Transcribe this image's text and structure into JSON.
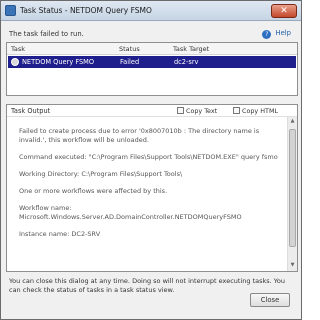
{
  "window": {
    "title": "Task Status - NETDOM Query FSMO",
    "close_glyph": "✕"
  },
  "status_message": "The task failed to run.",
  "help_label": "Help",
  "table": {
    "headers": [
      "Task",
      "Status",
      "Task Target"
    ],
    "rows": [
      {
        "task": "NETDOM Query FSMO",
        "status": "Failed",
        "target": "dc2-srv"
      }
    ]
  },
  "output": {
    "label": "Task Output",
    "copy_text": "Copy Text",
    "copy_html": "Copy HTML",
    "paragraphs": [
      "Failed to create process due to error '0x8007010b : The directory name is invalid.', this workflow will be unloaded.",
      "Command executed: \"C:\\Program Files\\Support Tools\\NETDOM.EXE\" query fsmo",
      "Working Directory: C:\\Program Files\\Support Tools\\",
      "One or more workflows were affected by this.",
      "Workflow name: Microsoft.Windows.Server.AD.DomainController.NETDOMQueryFSMO",
      "Instance name: DC2-SRV"
    ]
  },
  "footer_text": "You can close this dialog at any time.  Doing so will not interrupt executing tasks.  You can check the status of tasks in a task status view.",
  "close_button": "Close"
}
